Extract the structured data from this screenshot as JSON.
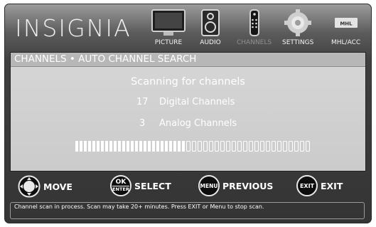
{
  "brand": "INSIGNIA",
  "menu": [
    {
      "label": "PICTURE",
      "icon": "tv-icon"
    },
    {
      "label": "AUDIO",
      "icon": "speaker-icon"
    },
    {
      "label": "CHANNELS",
      "icon": "remote-icon"
    },
    {
      "label": "SETTINGS",
      "icon": "gear-icon"
    },
    {
      "label": "MHL/ACC",
      "icon": "mhl-icon",
      "badge": "MHL"
    }
  ],
  "active_menu": "CHANNELS",
  "panel": {
    "title": "CHANNELS • AUTO CHANNEL SEARCH",
    "heading": "Scanning for channels",
    "digital_count": "17",
    "digital_label": "Digital Channels",
    "analog_count": "3",
    "analog_label": "Analog Channels",
    "progress": {
      "filled": 26,
      "total": 48
    }
  },
  "buttons": [
    {
      "key": "",
      "label": "MOVE",
      "icon": "dpad-icon"
    },
    {
      "key": "OK ENTER",
      "key_top": "OK",
      "key_bottom": "ENTER",
      "label": "SELECT"
    },
    {
      "key": "MENU",
      "label": "PREVIOUS"
    },
    {
      "key": "EXIT",
      "label": "EXIT"
    }
  ],
  "status_text": "Channel scan in process. Scan may take 20+ minutes. Press EXIT or Menu to stop scan."
}
